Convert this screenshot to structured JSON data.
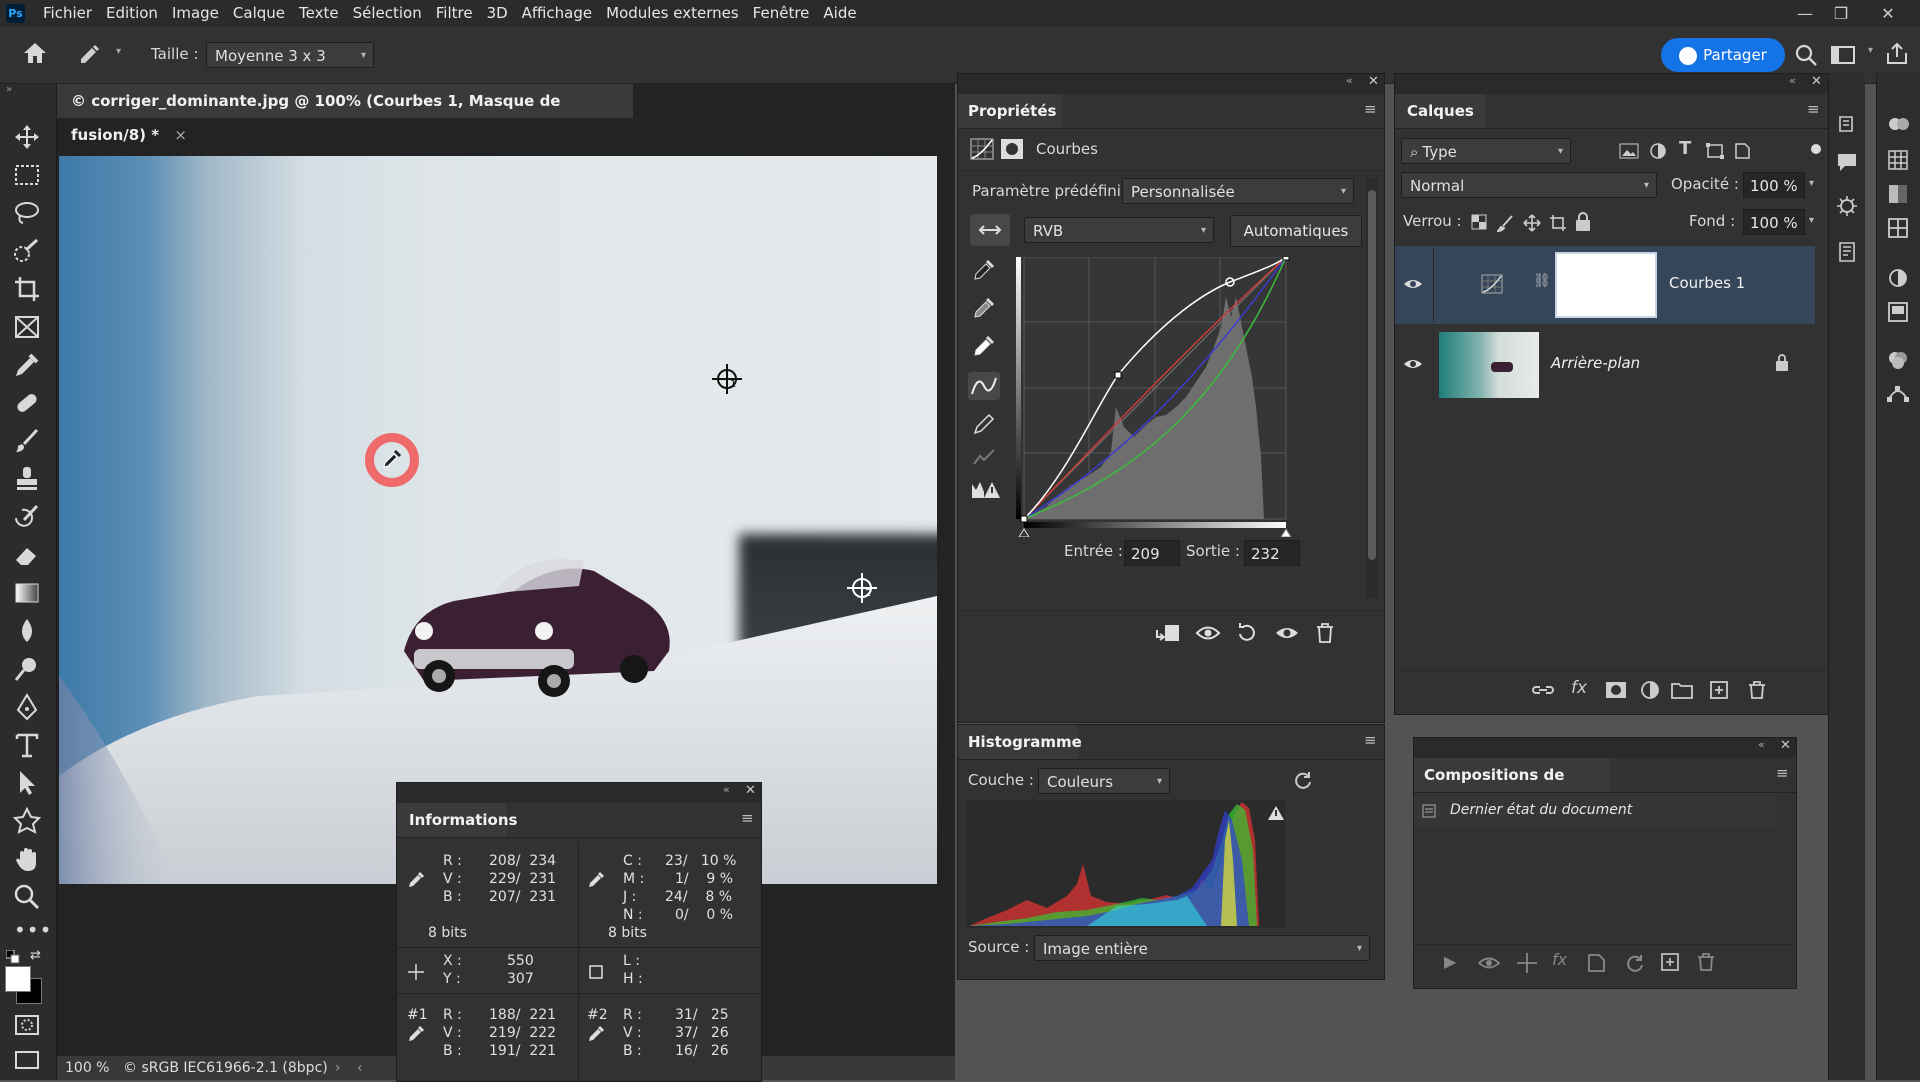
{
  "menubar": {
    "items": [
      "Fichier",
      "Edition",
      "Image",
      "Calque",
      "Texte",
      "Sélection",
      "Filtre",
      "3D",
      "Affichage",
      "Modules externes",
      "Fenêtre",
      "Aide"
    ],
    "app_icon": "Ps"
  },
  "options": {
    "size_label": "Taille :",
    "size_value": "Moyenne 3 x 3",
    "share_label": "Partager"
  },
  "document": {
    "tab_title": "© corriger_dominante.jpg @ 100% (Courbes 1, Masque de fusion/8) *",
    "zoom": "100 %",
    "profile": "© sRGB IEC61966-2.1 (8bpc)",
    "sampler1": "1",
    "sampler2": "2"
  },
  "properties": {
    "title": "Propriétés",
    "type_label": "Courbes",
    "preset_label": "Paramètre prédéfini :",
    "preset_value": "Personnalisée",
    "channel_value": "RVB",
    "auto_label": "Automatiques",
    "input_label": "Entrée :",
    "input_value": "209",
    "output_label": "Sortie :",
    "output_value": "232"
  },
  "histogram": {
    "title": "Histogramme",
    "channel_label": "Couche :",
    "channel_value": "Couleurs",
    "source_label": "Source :",
    "source_value": "Image entière"
  },
  "layers": {
    "title": "Calques",
    "filter_value": "Type",
    "blend_mode": "Normal",
    "opacity_label": "Opacité :",
    "opacity_value": "100 %",
    "lock_label": "Verrou :",
    "fill_label": "Fond :",
    "fill_value": "100 %",
    "items": [
      {
        "name": "Courbes 1"
      },
      {
        "name": "Arrière-plan"
      }
    ]
  },
  "compositions": {
    "title": "Compositions de calques",
    "items": [
      "Dernier état du document"
    ]
  },
  "info": {
    "title": "Informations",
    "rgb_labels": [
      "R :",
      "V :",
      "B :"
    ],
    "rgb_values": [
      "208/  234",
      "229/  231",
      "207/  231"
    ],
    "cmyk_labels": [
      "C :",
      "M :",
      "J :",
      "N :"
    ],
    "cmyk_values": [
      "23/   10 %",
      "1/    9 %",
      "24/    8 %",
      "0/    0 %"
    ],
    "bits_left": "8 bits",
    "bits_right": "8 bits",
    "x_label": "X :",
    "x_value": "550",
    "y_label": "Y :",
    "y_value": "307",
    "l_label": "L :",
    "h_label": "H :",
    "s1_label": "#1",
    "s1_values": [
      "188/  221",
      "219/  222",
      "191/  221"
    ],
    "s2_label": "#2",
    "s2_values": [
      "31/   25",
      "37/   26",
      "16/   26"
    ]
  }
}
